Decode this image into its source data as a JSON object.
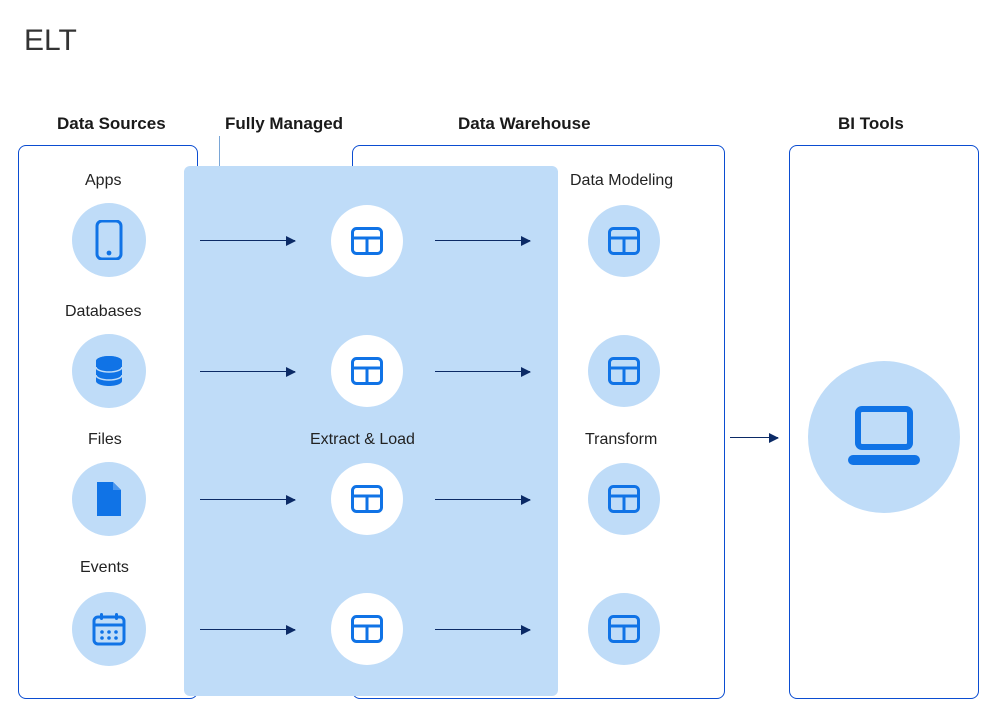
{
  "title": "ELT",
  "sections": {
    "sources": "Data Sources",
    "managed": "Fully Managed",
    "warehouse": "Data Warehouse",
    "bi": "BI Tools"
  },
  "sources": {
    "apps": "Apps",
    "databases": "Databases",
    "files": "Files",
    "events": "Events"
  },
  "pipeline": {
    "extract_load": "Extract & Load",
    "transform": "Transform",
    "data_modeling": "Data Modeling"
  },
  "colors": {
    "brand_blue": "#1073e6",
    "light_blue": "#bfdcf8",
    "outline_blue": "#0b4dd1"
  }
}
